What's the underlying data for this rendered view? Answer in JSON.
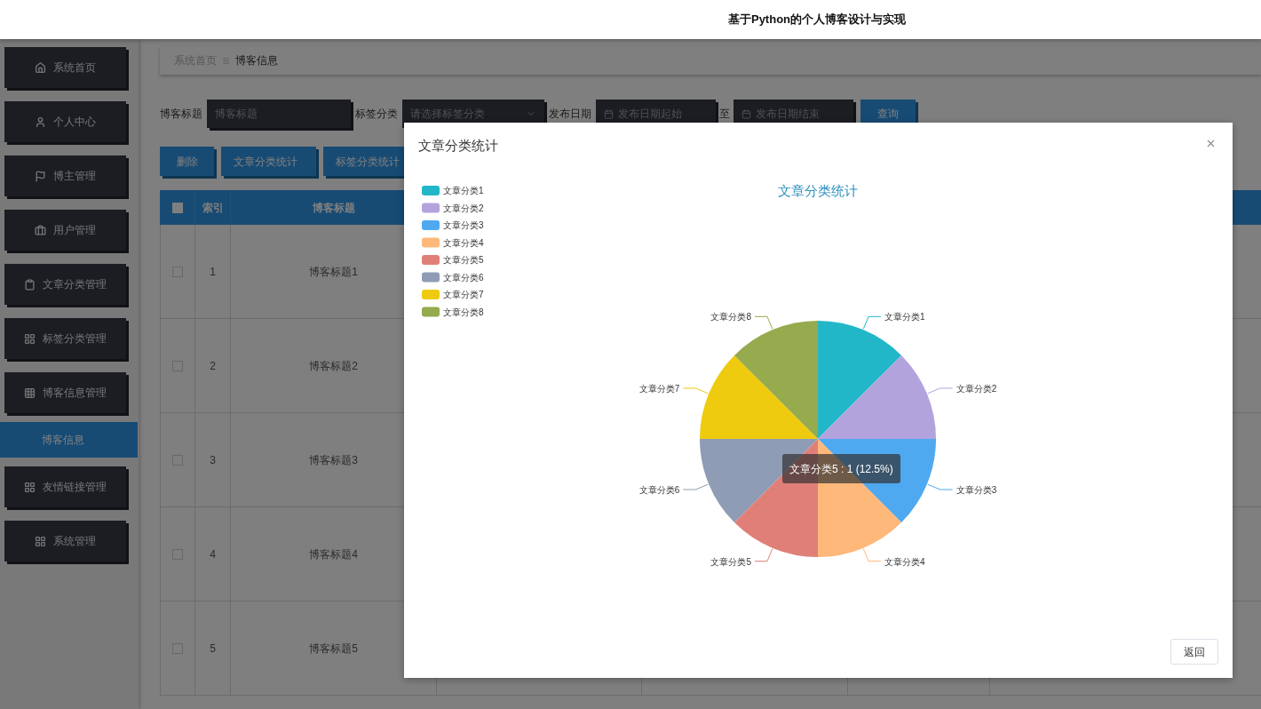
{
  "header": {
    "title": "基于Python的个人博客设计与实现"
  },
  "sidebar": {
    "items": [
      {
        "label": "系统首页"
      },
      {
        "label": "个人中心"
      },
      {
        "label": "博主管理"
      },
      {
        "label": "用户管理"
      },
      {
        "label": "文章分类管理"
      },
      {
        "label": "标签分类管理"
      },
      {
        "label": "博客信息管理",
        "children": [
          {
            "label": "博客信息",
            "selected": true
          }
        ]
      },
      {
        "label": "友情链接管理"
      },
      {
        "label": "系统管理"
      }
    ]
  },
  "breadcrumb": [
    "系统首页",
    "博客信息"
  ],
  "filters": [
    {
      "kind": "text",
      "label": "博客标题",
      "placeholder": "博客标题"
    },
    {
      "kind": "select",
      "label": "标签分类",
      "placeholder": "请选择标签分类"
    },
    {
      "kind": "daterange",
      "label": "发布日期",
      "start_placeholder": "发布日期起始",
      "separator": "至",
      "end_placeholder": "发布日期结束"
    }
  ],
  "search_button": "查询",
  "actions": [
    "删除",
    "文章分类统计",
    "标签分类统计"
  ],
  "table": {
    "select_all_checked": false,
    "columns": [
      "索引",
      "博客标题"
    ],
    "rows": [
      {
        "checked": false,
        "index": "1",
        "title": "博客标题1"
      },
      {
        "checked": false,
        "index": "2",
        "title": "博客标题2"
      },
      {
        "checked": false,
        "index": "3",
        "title": "博客标题3"
      },
      {
        "checked": false,
        "index": "4",
        "title": "博客标题4"
      },
      {
        "checked": false,
        "index": "5",
        "title": "博客标题5"
      }
    ]
  },
  "modal": {
    "title": "文章分类统计",
    "chart_data": {
      "type": "pie",
      "title": "文章分类统计",
      "legend": true,
      "categories": [
        "文章分类1",
        "文章分类2",
        "文章分类3",
        "文章分类4",
        "文章分类5",
        "文章分类6",
        "文章分类7",
        "文章分类8"
      ],
      "colors": [
        "#22b7c8",
        "#b3a3dd",
        "#4fa9f0",
        "#fdb87a",
        "#e07f78",
        "#8f9cb5",
        "#eecb0e",
        "#96aa4e"
      ],
      "values": [
        1,
        1,
        1,
        1,
        1,
        1,
        1,
        1
      ]
    },
    "tooltip": "文章分类5 : 1 (12.5%)",
    "buttons": [
      "返回"
    ]
  }
}
